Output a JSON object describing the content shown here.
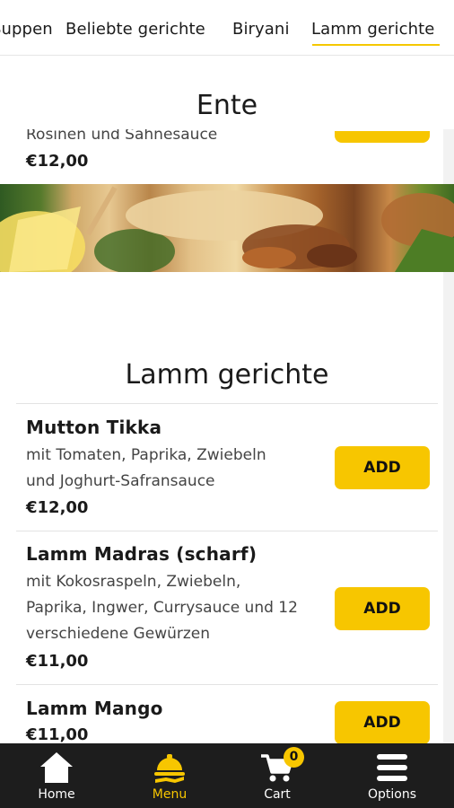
{
  "tabs": [
    {
      "label": "Suppen"
    },
    {
      "label": "Beliebte gerichte"
    },
    {
      "label": "Biryani"
    },
    {
      "label": "Lamm gerichte"
    }
  ],
  "active_tab": "Lamm gerichte",
  "ente": {
    "title": "Ente",
    "partial_desc": "Rosinen und Sahnesauce",
    "price": "€12,00"
  },
  "lamm": {
    "title": "Lamm gerichte",
    "items": [
      {
        "name": "Mutton Tikka",
        "desc_lines": [
          "mit Tomaten, Paprika, Zwiebeln",
          "und Joghurt-Safransauce"
        ],
        "price": "€12,00",
        "add_label": "ADD"
      },
      {
        "name": "Lamm Madras (scharf)",
        "desc_lines": [
          "mit Kokosraspeln, Zwiebeln,",
          "Paprika, Ingwer, Currysauce und 12",
          "verschiedene Gewürzen"
        ],
        "price": "€11,00",
        "add_label": "ADD"
      },
      {
        "name": "Lamm Mango",
        "desc_lines": [],
        "price": "€11,00",
        "add_label": "ADD"
      }
    ]
  },
  "bottom_nav": [
    {
      "label": "Home",
      "icon": "home-icon"
    },
    {
      "label": "Menu",
      "icon": "food-tray-icon"
    },
    {
      "label": "Cart",
      "icon": "cart-icon",
      "badge": "0"
    },
    {
      "label": "Options",
      "icon": "menu-lines-icon"
    }
  ],
  "colors": {
    "accent": "#f7c600",
    "nav_background": "#1d1d1d",
    "text": "#1a1a1a"
  }
}
